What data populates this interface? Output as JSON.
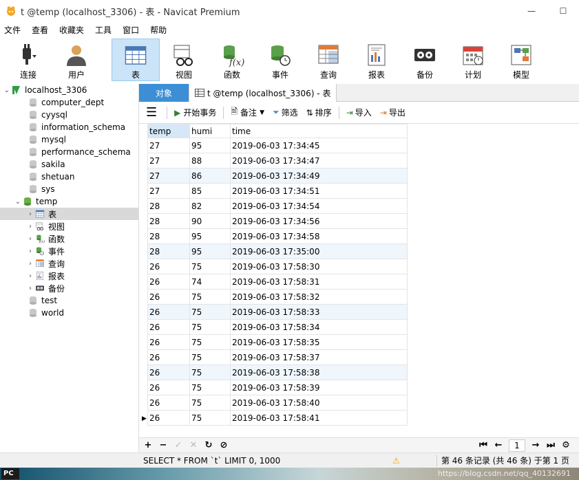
{
  "window": {
    "title": "t @temp (localhost_3306) - 表 - Navicat Premium"
  },
  "menu": [
    "文件",
    "查看",
    "收藏夹",
    "工具",
    "窗口",
    "帮助"
  ],
  "toolbar": {
    "connect": "连接",
    "user": "用户",
    "items": [
      {
        "label": "表",
        "icon": "table-icon",
        "active": true
      },
      {
        "label": "视图",
        "icon": "view-icon"
      },
      {
        "label": "函数",
        "icon": "function-icon"
      },
      {
        "label": "事件",
        "icon": "event-icon"
      },
      {
        "label": "查询",
        "icon": "query-icon"
      },
      {
        "label": "报表",
        "icon": "report-icon"
      },
      {
        "label": "备份",
        "icon": "backup-icon"
      },
      {
        "label": "计划",
        "icon": "schedule-icon"
      },
      {
        "label": "模型",
        "icon": "model-icon"
      }
    ]
  },
  "sidebar": {
    "connection": "localhost_3306",
    "databases_before": [
      "computer_dept",
      "cyysql",
      "information_schema",
      "mysql",
      "performance_schema",
      "sakila",
      "shetuan",
      "sys"
    ],
    "open_db": "temp",
    "open_db_children": [
      {
        "label": "表",
        "icon": "table-icon",
        "selected": true
      },
      {
        "label": "视图",
        "icon": "view-icon"
      },
      {
        "label": "函数",
        "icon": "function-icon"
      },
      {
        "label": "事件",
        "icon": "event-icon"
      },
      {
        "label": "查询",
        "icon": "query-icon"
      },
      {
        "label": "报表",
        "icon": "report-icon"
      },
      {
        "label": "备份",
        "icon": "backup-icon"
      }
    ],
    "databases_after": [
      "test",
      "world"
    ]
  },
  "tabs": {
    "objects": "对象",
    "active": "t @temp (localhost_3306) - 表"
  },
  "gridbar": {
    "begin_tx": "开始事务",
    "note": "备注",
    "filter": "筛选",
    "sort": "排序",
    "import": "导入",
    "export": "导出"
  },
  "grid": {
    "columns": [
      "temp",
      "humi",
      "time"
    ],
    "rows": [
      [
        "27",
        "95",
        "2019-06-03 17:34:45"
      ],
      [
        "27",
        "88",
        "2019-06-03 17:34:47"
      ],
      [
        "27",
        "86",
        "2019-06-03 17:34:49"
      ],
      [
        "27",
        "85",
        "2019-06-03 17:34:51"
      ],
      [
        "28",
        "82",
        "2019-06-03 17:34:54"
      ],
      [
        "28",
        "90",
        "2019-06-03 17:34:56"
      ],
      [
        "28",
        "95",
        "2019-06-03 17:34:58"
      ],
      [
        "28",
        "95",
        "2019-06-03 17:35:00"
      ],
      [
        "26",
        "75",
        "2019-06-03 17:58:30"
      ],
      [
        "26",
        "74",
        "2019-06-03 17:58:31"
      ],
      [
        "26",
        "75",
        "2019-06-03 17:58:32"
      ],
      [
        "26",
        "75",
        "2019-06-03 17:58:33"
      ],
      [
        "26",
        "75",
        "2019-06-03 17:58:34"
      ],
      [
        "26",
        "75",
        "2019-06-03 17:58:35"
      ],
      [
        "26",
        "75",
        "2019-06-03 17:58:37"
      ],
      [
        "26",
        "75",
        "2019-06-03 17:58:38"
      ],
      [
        "26",
        "75",
        "2019-06-03 17:58:39"
      ],
      [
        "26",
        "75",
        "2019-06-03 17:58:40"
      ],
      [
        "26",
        "75",
        "2019-06-03 17:58:41"
      ]
    ]
  },
  "navbar": {
    "page": "1"
  },
  "status": {
    "sql": "SELECT * FROM `t` LIMIT 0, 1000",
    "records": "第 46 条记录 (共 46 条) 于第 1 页"
  },
  "taskbar": {
    "pc": "PC",
    "watermark": "https://blog.csdn.net/qq_40132691"
  },
  "colors": {
    "accent": "#3c8fd6",
    "selection": "#cce4f7",
    "row_alt": "#eff6fc"
  }
}
